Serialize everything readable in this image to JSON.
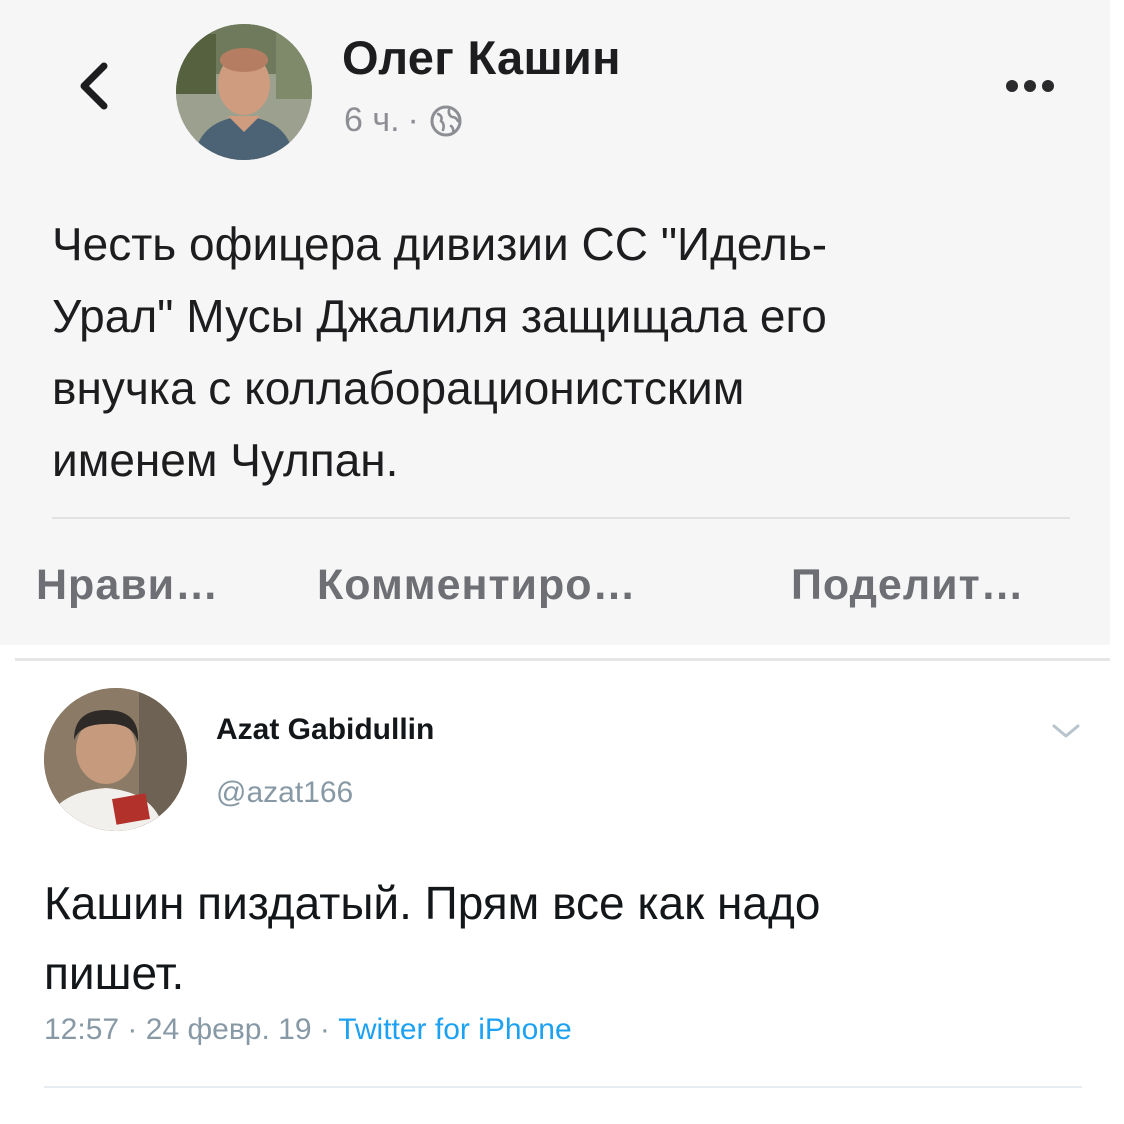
{
  "facebook_post": {
    "author": "Олег Кашин",
    "time": "6 ч.",
    "separator": "·",
    "text": "Честь офицера дивизии СС \"Идель-\nУрал\" Мусы Джалиля защищала его\nвнучка с коллаборационистским\nименем Чулпан.",
    "actions": {
      "like": "Нрави…",
      "comment": "Комментиро…",
      "share": "Поделит…"
    },
    "icons": {
      "back": "chevron-left-icon",
      "privacy": "globe-icon",
      "more": "more-horizontal-icon"
    }
  },
  "tweet": {
    "name": "Azat Gabidullin",
    "handle": "@azat166",
    "text": "Кашин пиздатый. Прям все как надо\nпишет.",
    "time": "12:57",
    "date": "24 февр. 19",
    "sep1": "·",
    "sep2": "·",
    "source": "Twitter for iPhone",
    "icons": {
      "menu": "chevron-down-icon"
    }
  },
  "colors": {
    "facebook_background": "#f6f6f7",
    "meta_gray": "#8c8e93",
    "action_gray": "#6d6f74",
    "twitter_blue": "#1da1f2",
    "twitter_gray": "#8899a6"
  }
}
